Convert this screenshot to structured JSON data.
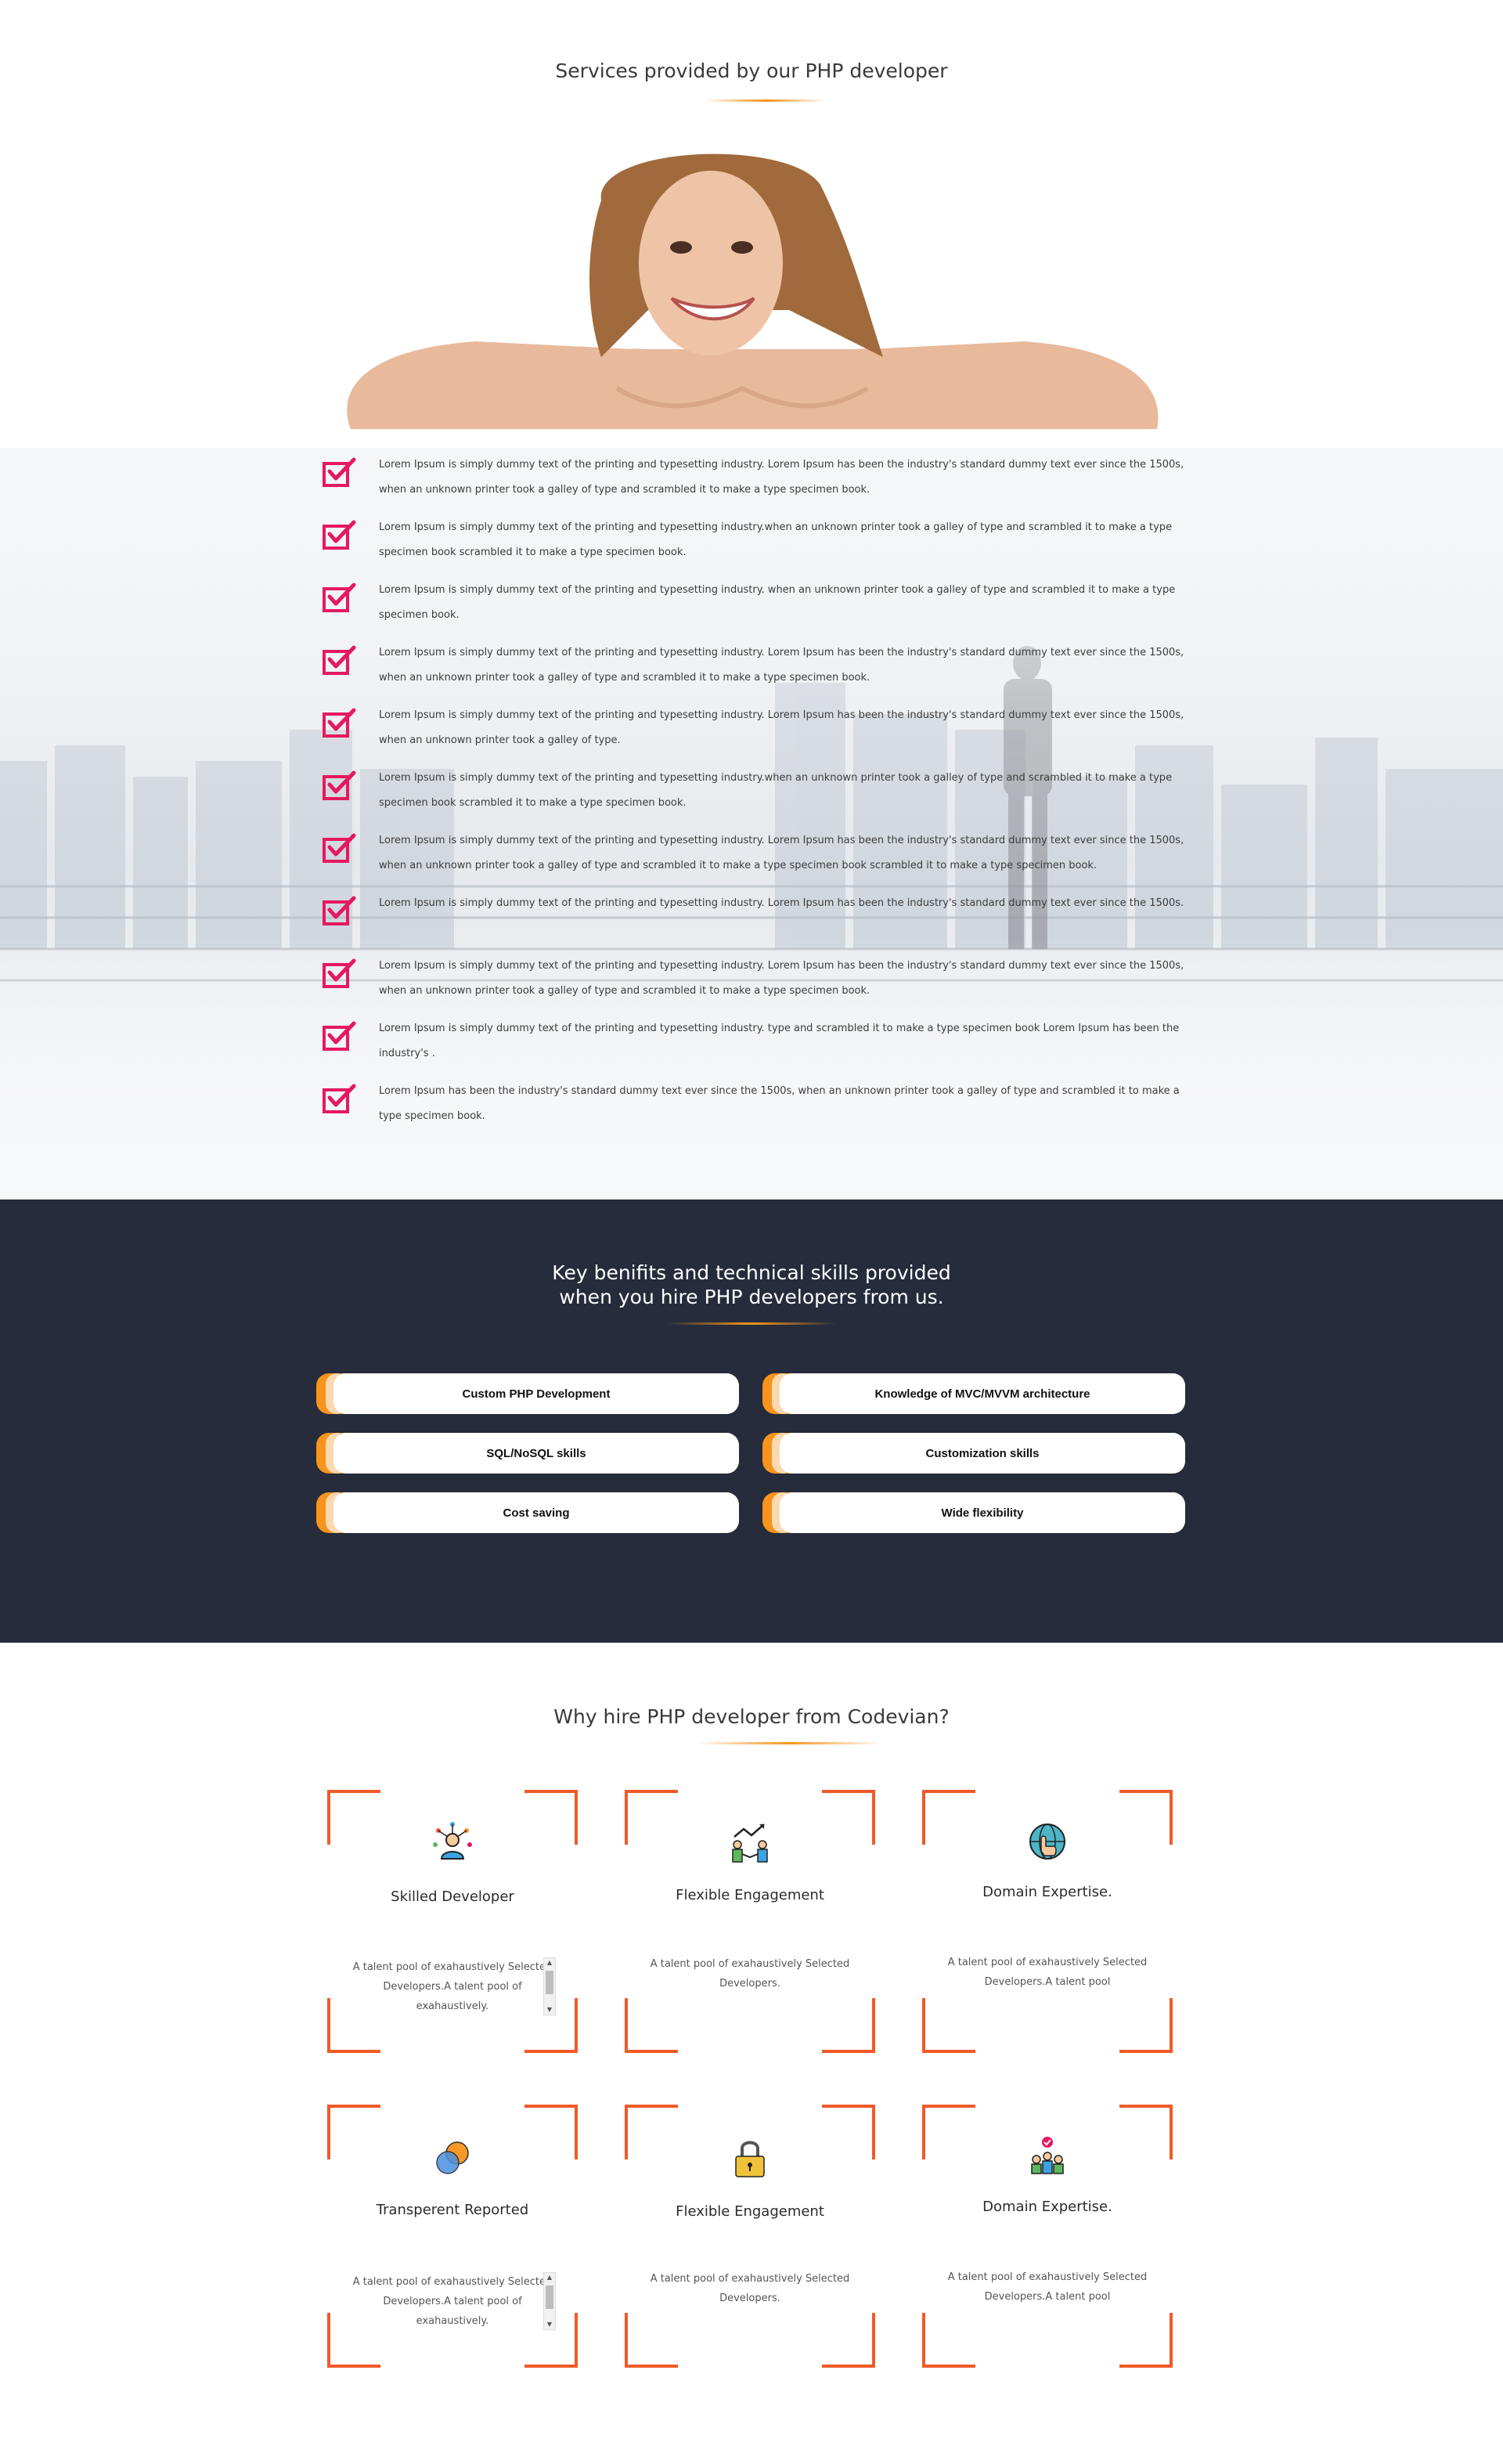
{
  "services": {
    "title": "Services provided by our PHP developer",
    "items": [
      "Lorem Ipsum is simply dummy text of the printing and typesetting industry. Lorem Ipsum has been the industry's standard dummy text ever since the 1500s, when an unknown printer took a galley of type and scrambled it to make a type specimen book.",
      "Lorem Ipsum is simply dummy text of the printing and typesetting industry.when an unknown printer took a galley of type and scrambled it to make a type specimen book scrambled it to make a type specimen book.",
      "Lorem Ipsum is simply dummy text of the printing and typesetting industry. when an unknown printer took a galley of type and scrambled it to make a type specimen book.",
      "Lorem Ipsum is simply dummy text of the printing and typesetting industry. Lorem Ipsum has been the industry's standard dummy text ever since the 1500s, when an unknown printer took a galley of type and scrambled it to make a type specimen book.",
      "Lorem Ipsum is simply dummy text of the printing and typesetting industry. Lorem Ipsum has been the industry's standard dummy text ever since the 1500s, when an unknown printer took a galley of type.",
      "Lorem Ipsum is simply dummy text of the printing and typesetting industry.when an unknown printer took a galley of type and scrambled it to make a type specimen book scrambled it to make a type specimen book.",
      "Lorem Ipsum is simply dummy text of the printing and typesetting industry. Lorem Ipsum has been the industry's standard dummy text ever since the 1500s, when an unknown printer took a galley of type and scrambled it to make a type specimen book scrambled it to make a type specimen book.",
      "Lorem Ipsum is simply dummy text of the printing and typesetting industry. Lorem Ipsum has been the industry's standard dummy text ever since the 1500s.",
      "Lorem Ipsum is simply dummy text of the printing and typesetting industry. Lorem Ipsum has been the industry's standard dummy text ever since the 1500s, when an unknown printer took a galley of type and scrambled it to make a type specimen book.",
      "Lorem Ipsum is simply dummy text of the printing and typesetting industry. type and scrambled it to make a type specimen book Lorem Ipsum has been the industry's .",
      "Lorem Ipsum has been the industry's standard dummy text ever since the 1500s, when an unknown printer took a galley of type and scrambled it to make a type specimen book."
    ]
  },
  "benefits": {
    "title_line1": "Key benifits and technical skills provided",
    "title_line2": "when you hire PHP developers from us.",
    "pills": [
      "Custom PHP Development",
      "Knowledge of MVC/MVVM architecture",
      "SQL/NoSQL skills",
      "Customization skills",
      "Cost saving",
      "Wide flexibility"
    ]
  },
  "why": {
    "title": "Why hire PHP developer from Codevian?",
    "cards": [
      {
        "icon": "developer-icon",
        "title": "Skilled Developer",
        "text": "A talent pool of exahaustively Selected Developers.A talent pool of exahaustively."
      },
      {
        "icon": "handshake-growth-icon",
        "title": "Flexible Engagement",
        "text": "A talent pool of exahaustively Selected Developers."
      },
      {
        "icon": "globe-hand-icon",
        "title": "Domain Expertise.",
        "text": "A talent pool of exahaustively Selected Developers.A talent pool"
      },
      {
        "icon": "overlap-circles-icon",
        "title": "Transperent Reported",
        "text": "A talent pool of exahaustively Selected Developers.A talent pool of exahaustively."
      },
      {
        "icon": "padlock-icon",
        "title": "Flexible Engagement",
        "text": "A talent pool of exahaustively Selected Developers."
      },
      {
        "icon": "team-check-icon",
        "title": "Domain Expertise.",
        "text": "A talent pool of exahaustively Selected Developers.A talent pool"
      }
    ]
  },
  "colors": {
    "accent": "#f7941d",
    "check": "#e5195f",
    "dark": "#262c3b",
    "corner": "#f05a28"
  }
}
